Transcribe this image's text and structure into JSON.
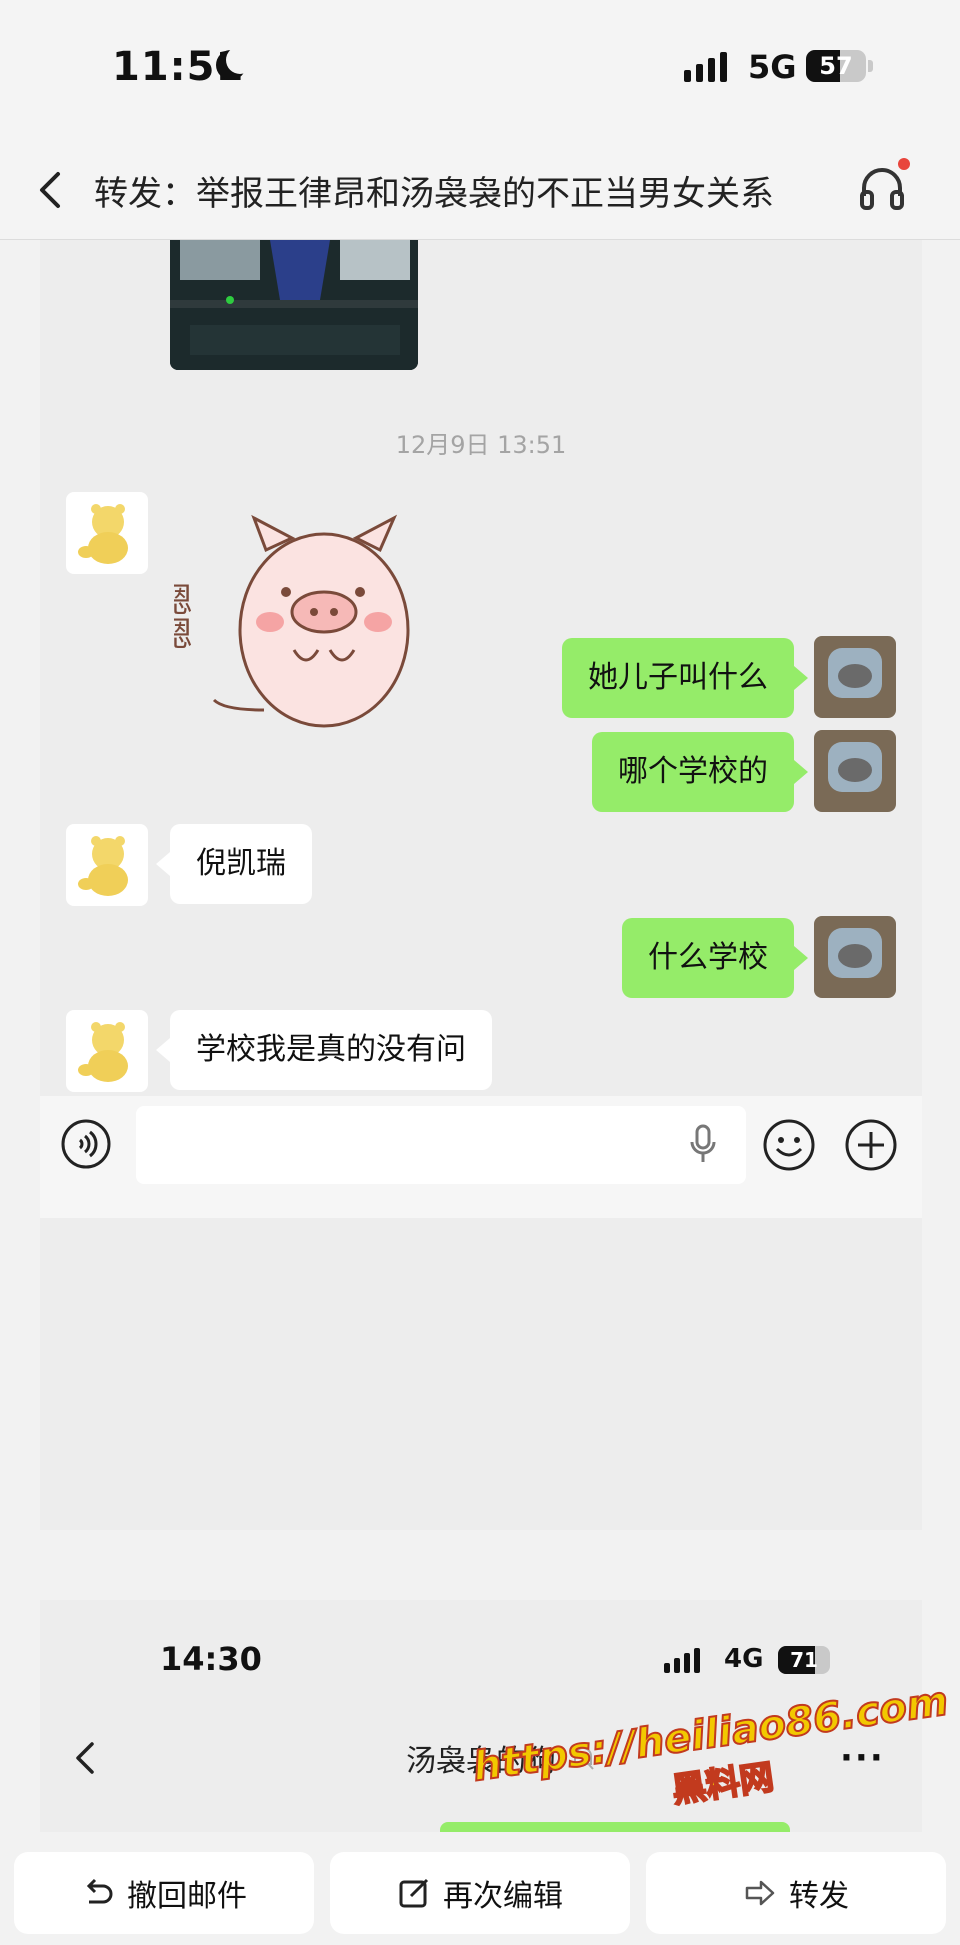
{
  "status_bar": {
    "time": "11:51",
    "network": "5G",
    "battery": "57",
    "battery_level": 0.57
  },
  "header": {
    "title": "转发：举报王律昂和汤袅袅的不正当男女关系"
  },
  "chat": {
    "timestamp": "12月9日 13:51",
    "sticker_text": "嗯嗯",
    "messages": [
      {
        "side": "out",
        "text": "她儿子叫什么"
      },
      {
        "side": "out",
        "text": "哪个学校的"
      },
      {
        "side": "in",
        "text": "倪凯瑞"
      },
      {
        "side": "out",
        "text": "什么学校"
      },
      {
        "side": "in",
        "text": "学校我是真的没有问"
      }
    ],
    "input_placeholder": ""
  },
  "second_screenshot": {
    "time": "14:30",
    "network": "4G",
    "battery": "71",
    "battery_level": 0.71,
    "title": "汤袅袅的狗",
    "more": "···"
  },
  "watermark": {
    "url": "https://heiliao86.com",
    "name": "黑料网"
  },
  "toolbar": {
    "recall_label": "撤回邮件",
    "edit_label": "再次编辑",
    "forward_label": "转发"
  }
}
